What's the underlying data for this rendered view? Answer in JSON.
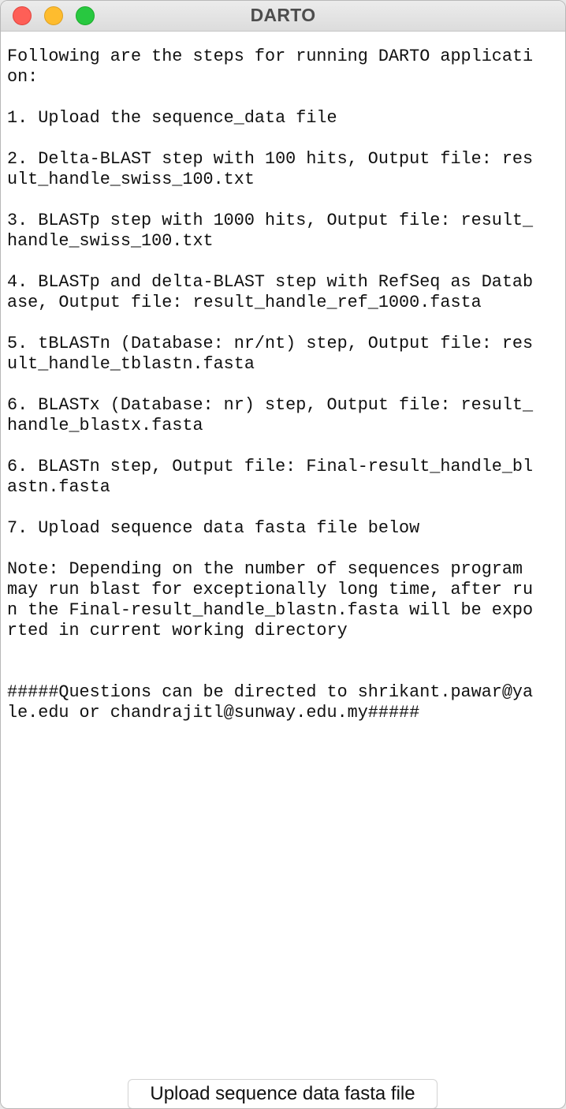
{
  "window": {
    "title": "DARTO"
  },
  "content": {
    "lines": [
      "Following are the steps for running DARTO applicati",
      "on:",
      "",
      "1. Upload the sequence_data file",
      "",
      "2. Delta-BLAST step with 100 hits, Output file: res",
      "ult_handle_swiss_100.txt",
      "",
      "3. BLASTp step with 1000 hits, Output file: result_",
      "handle_swiss_100.txt",
      "",
      "4. BLASTp and delta-BLAST step with RefSeq as Datab",
      "ase, Output file: result_handle_ref_1000.fasta",
      "",
      "5. tBLASTn (Database: nr/nt) step, Output file: res",
      "ult_handle_tblastn.fasta",
      "",
      "6. BLASTx (Database: nr) step, Output file: result_",
      "handle_blastx.fasta",
      "",
      "6. BLASTn step, Output file: Final-result_handle_bl",
      "astn.fasta",
      "",
      "7. Upload sequence data fasta file below",
      "",
      "Note: Depending on the number of sequences program ",
      "may run blast for exceptionally long time, after ru",
      "n the Final-result_handle_blastn.fasta will be expo",
      "rted in current working directory",
      "",
      "",
      "#####Questions can be directed to shrikant.pawar@ya",
      "le.edu or chandrajitl@sunway.edu.my#####"
    ]
  },
  "upload_button": {
    "label": "Upload sequence data fasta file"
  }
}
